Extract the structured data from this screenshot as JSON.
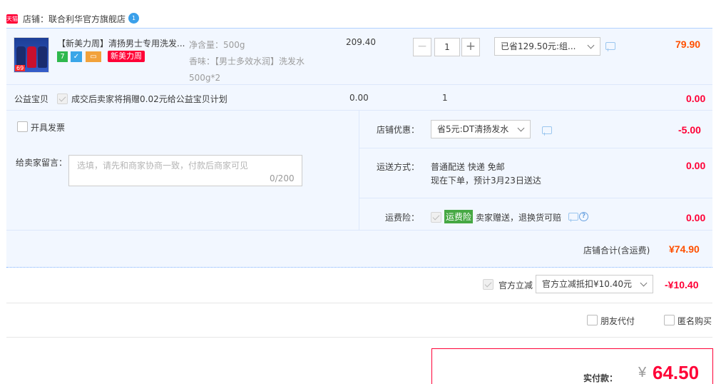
{
  "store": {
    "badge": "天猫",
    "name": "店铺：联合利华官方旗舰店",
    "chat_badge": "1"
  },
  "item": {
    "thumb_tag": "69",
    "title": "【新美力周】清扬男士专用洗发...",
    "promo_badge": "新美力周",
    "sku_weight": "净含量：500g",
    "sku_flavor": "香味：【男士多效水润】洗发水500g*2",
    "unit_price": "209.40",
    "quantity": "1",
    "discount_select": "已省129.50元:组...",
    "subtotal": "79.90"
  },
  "charity": {
    "label": "公益宝贝",
    "text": "成交后卖家将捐赠0.02元给公益宝贝计划",
    "price": "0.00",
    "quantity": "1",
    "subtotal": "0.00"
  },
  "invoice": {
    "label": "开具发票"
  },
  "message": {
    "label": "给卖家留言：",
    "placeholder": "选填，请先和商家协商一致，付款后商家可见",
    "counter": "0/200"
  },
  "store_discount": {
    "label": "店铺优惠：",
    "select": "省5元:DT清扬发水",
    "amount": "-5.00"
  },
  "shipping": {
    "label": "运送方式：",
    "method": "普通配送 快递 免邮",
    "eta": "现在下单，预计3月23日送达",
    "amount": "0.00"
  },
  "insurance": {
    "label": "运费险：",
    "tag": "运费险",
    "text": "卖家赠送，退换货可赔",
    "amount": "0.00"
  },
  "store_total": {
    "label": "店铺合计(含运费)",
    "amount": "¥74.90"
  },
  "official_discount": {
    "label": "官方立减",
    "select": "官方立减抵扣¥10.40元",
    "amount": "-¥10.40"
  },
  "options": {
    "friend_pay": "朋友代付",
    "anonymous": "匿名购买"
  },
  "payment": {
    "label": "实付款：",
    "currency": "¥",
    "amount": "64.50"
  },
  "colors": {
    "accent_red": "#ff0036",
    "accent_orange": "#ff5000",
    "panel_bg": "#f2f7ff",
    "panel_border": "#b2d1ff"
  }
}
